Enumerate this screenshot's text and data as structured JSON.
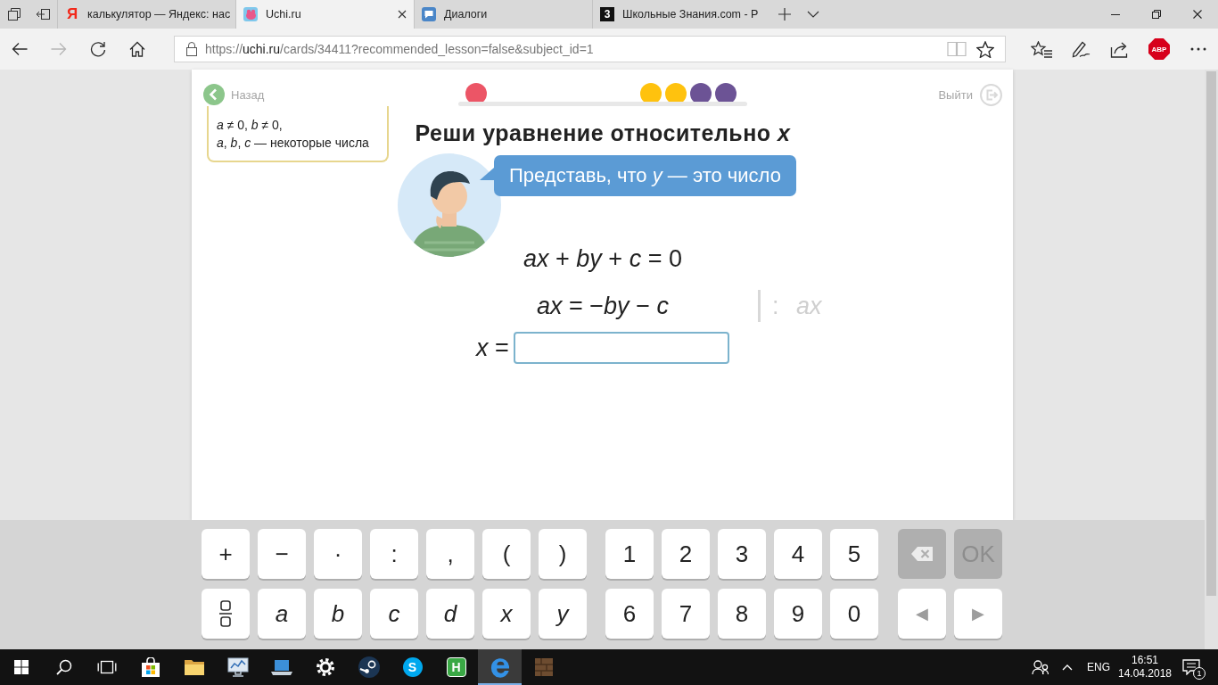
{
  "browser": {
    "tabs": [
      {
        "title": "калькулятор — Яндекс: нас",
        "selected": false,
        "favicon": {
          "kind": "letter",
          "glyph": "Я"
        }
      },
      {
        "title": "Uchi.ru",
        "selected": true,
        "favicon": {
          "kind": "tile"
        }
      },
      {
        "title": "Диалоги",
        "selected": false,
        "favicon": {
          "kind": "chat"
        }
      },
      {
        "title": "Школьные Знания.com - Р",
        "selected": false,
        "favicon": {
          "kind": "badge",
          "glyph": "3"
        }
      }
    ],
    "nav_buttons": [
      {
        "kind": "back",
        "disabled": false
      },
      {
        "kind": "forward",
        "disabled": true
      },
      {
        "kind": "refresh",
        "disabled": false
      },
      {
        "kind": "home",
        "disabled": false
      }
    ],
    "address": {
      "scheme": "https://",
      "domain": "uchi.ru",
      "path": "/cards/34411?recommended_lesson=false&subject_id=1"
    },
    "field_buttons": [
      {
        "kind": "reading",
        "disabled": true
      },
      {
        "kind": "favorite",
        "disabled": false
      }
    ],
    "toolbar_buttons": [
      {
        "kind": "hub"
      },
      {
        "kind": "notes"
      },
      {
        "kind": "share"
      },
      {
        "kind": "adblock",
        "label": "ABP"
      },
      {
        "kind": "more"
      }
    ]
  },
  "lesson": {
    "back_label": "Назад",
    "exit_label": "Выйти",
    "progress": [
      {
        "kind": "marker",
        "color": "#ec5566"
      },
      {
        "kind": "result",
        "color": "#ffc20e"
      },
      {
        "kind": "result",
        "color": "#ffc20e"
      },
      {
        "kind": "result",
        "color": "#6c5395"
      },
      {
        "kind": "result",
        "color": "#6c5395"
      }
    ],
    "conditions": [
      "*a* ≠ 0, *b* ≠ 0,",
      "*a*, *b*, *c* — некоторые числа"
    ],
    "title": "Реши уравнение относительно *x*",
    "hint": "Представь, что *y* — это число",
    "steps": [
      {
        "equation": "*ax* + *by* + *c* = 0"
      },
      {
        "equation": "*ax* = −*by* − *c*",
        "operation": ": *ax*"
      }
    ],
    "answer": {
      "label": "*x* ="
    }
  },
  "keyboard": {
    "symbol_keys": [
      {
        "kind": "sign",
        "label": "+"
      },
      {
        "kind": "sign",
        "label": "−"
      },
      {
        "kind": "sign",
        "label": "·"
      },
      {
        "kind": "sign",
        "label": ":"
      },
      {
        "kind": "sign",
        "label": ","
      },
      {
        "kind": "sign",
        "label": "("
      },
      {
        "kind": "sign",
        "label": ")"
      },
      {
        "kind": "fraction"
      },
      {
        "kind": "letter",
        "label": "a"
      },
      {
        "kind": "letter",
        "label": "b"
      },
      {
        "kind": "letter",
        "label": "c"
      },
      {
        "kind": "letter",
        "label": "d"
      },
      {
        "kind": "letter",
        "label": "x"
      },
      {
        "kind": "letter",
        "label": "y"
      }
    ],
    "digit_keys": [
      "1",
      "2",
      "3",
      "4",
      "5",
      "6",
      "7",
      "8",
      "9",
      "0"
    ],
    "control_keys": [
      {
        "kind": "backspace",
        "disabled": true
      },
      {
        "kind": "confirm",
        "label": "OK",
        "disabled": true
      },
      {
        "kind": "left",
        "label": "◀",
        "disabled": false
      },
      {
        "kind": "right",
        "label": "▶",
        "disabled": false
      }
    ]
  },
  "taskbar": {
    "pinned": [
      {
        "kind": "bag",
        "selected": false
      },
      {
        "kind": "folder",
        "selected": false
      },
      {
        "kind": "chart",
        "selected": false
      },
      {
        "kind": "laptop",
        "selected": false
      },
      {
        "kind": "gear",
        "selected": false
      },
      {
        "kind": "disc",
        "selected": false
      },
      {
        "kind": "roundletter",
        "glyph": "S",
        "color": "#00a8ee",
        "selected": false
      },
      {
        "kind": "squareletter",
        "glyph": "H",
        "color": "#3aa845",
        "selected": false
      },
      {
        "kind": "browser",
        "selected": true
      },
      {
        "kind": "crate",
        "selected": false
      }
    ],
    "language": "ENG",
    "time": "16:51",
    "date": "14.04.2018",
    "notifications": "1"
  }
}
